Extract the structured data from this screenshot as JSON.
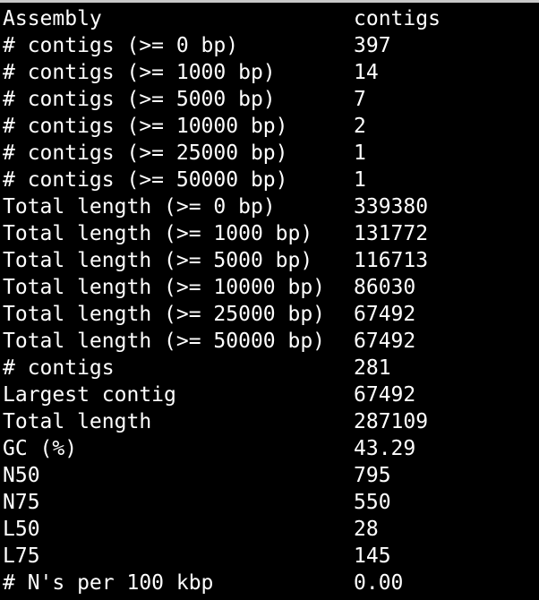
{
  "report": {
    "rows": [
      {
        "label": "Assembly",
        "value": "contigs"
      },
      {
        "label": "# contigs (>= 0 bp)",
        "value": "397"
      },
      {
        "label": "# contigs (>= 1000 bp)",
        "value": "14"
      },
      {
        "label": "# contigs (>= 5000 bp)",
        "value": "7"
      },
      {
        "label": "# contigs (>= 10000 bp)",
        "value": "2"
      },
      {
        "label": "# contigs (>= 25000 bp)",
        "value": "1"
      },
      {
        "label": "# contigs (>= 50000 bp)",
        "value": "1"
      },
      {
        "label": "Total length (>= 0 bp)",
        "value": "339380"
      },
      {
        "label": "Total length (>= 1000 bp)",
        "value": "131772"
      },
      {
        "label": "Total length (>= 5000 bp)",
        "value": "116713"
      },
      {
        "label": "Total length (>= 10000 bp)",
        "value": "86030"
      },
      {
        "label": "Total length (>= 25000 bp)",
        "value": "67492"
      },
      {
        "label": "Total length (>= 50000 bp)",
        "value": "67492"
      },
      {
        "label": "# contigs",
        "value": "281"
      },
      {
        "label": "Largest contig",
        "value": "67492"
      },
      {
        "label": "Total length",
        "value": "287109"
      },
      {
        "label": "GC (%)",
        "value": "43.29"
      },
      {
        "label": "N50",
        "value": "795"
      },
      {
        "label": "N75",
        "value": "550"
      },
      {
        "label": "L50",
        "value": "28"
      },
      {
        "label": "L75",
        "value": "145"
      },
      {
        "label": "# N's per 100 kbp",
        "value": "0.00"
      }
    ]
  },
  "colors": {
    "background": "#000000",
    "text": "#ffffff",
    "window_edge": "#c8c8c8"
  }
}
